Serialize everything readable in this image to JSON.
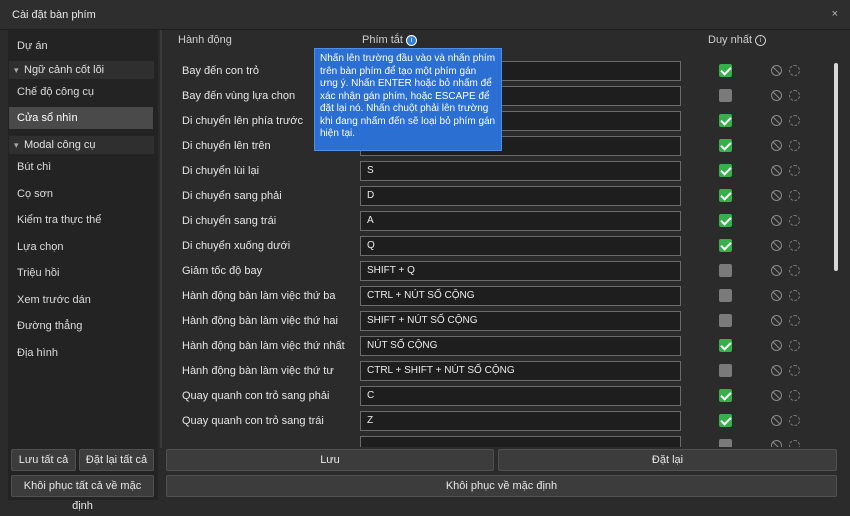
{
  "window": {
    "title": "Cài đặt bàn phím",
    "close": "×"
  },
  "sidebar": {
    "items": [
      {
        "label": "Dự án",
        "kind": "item"
      },
      {
        "label": "Ngữ cảnh cốt lõi",
        "kind": "group"
      },
      {
        "label": "Chế độ công cụ",
        "kind": "item"
      },
      {
        "label": "Cửa sổ nhìn",
        "kind": "item",
        "selected": true
      },
      {
        "label": "Modal công cụ",
        "kind": "group"
      },
      {
        "label": "Bút chì",
        "kind": "item"
      },
      {
        "label": "Cọ sơn",
        "kind": "item"
      },
      {
        "label": "Kiểm tra thực thể",
        "kind": "item"
      },
      {
        "label": "Lựa chọn",
        "kind": "item"
      },
      {
        "label": "Triệu hồi",
        "kind": "item"
      },
      {
        "label": "Xem trước dán",
        "kind": "item"
      },
      {
        "label": "Đường thẳng",
        "kind": "item"
      },
      {
        "label": "Địa hình",
        "kind": "item"
      }
    ],
    "save_all": "Lưu tất cả",
    "reset_all": "Đặt lại tất cả",
    "restore_all_defaults": "Khôi phục tất cả về mặc định"
  },
  "table": {
    "headers": {
      "action": "Hành động",
      "shortcut": "Phím tắt",
      "unique": "Duy nhất"
    },
    "rows": [
      {
        "action": "Bay đến con trỏ",
        "shortcut": "",
        "unique": true
      },
      {
        "action": "Bay đến vùng lựa chọn",
        "shortcut": "",
        "unique": false
      },
      {
        "action": "Di chuyển lên phía trước",
        "shortcut": "",
        "unique": true
      },
      {
        "action": "Di chuyển lên trên",
        "shortcut": "",
        "unique": true
      },
      {
        "action": "Di chuyển lùi lại",
        "shortcut": "S",
        "unique": true
      },
      {
        "action": "Di chuyển sang phải",
        "shortcut": "D",
        "unique": true
      },
      {
        "action": "Di chuyển sang trái",
        "shortcut": "A",
        "unique": true
      },
      {
        "action": "Di chuyển xuống dưới",
        "shortcut": "Q",
        "unique": true
      },
      {
        "action": "Giảm tốc độ bay",
        "shortcut": "SHIFT + Q",
        "unique": false
      },
      {
        "action": "Hành động bàn làm việc thứ ba",
        "shortcut": "CTRL + NÚT SỐ CỘNG",
        "unique": false
      },
      {
        "action": "Hành động bàn làm việc thứ hai",
        "shortcut": "SHIFT + NÚT SỐ CỘNG",
        "unique": false
      },
      {
        "action": "Hành động bàn làm việc thứ nhất",
        "shortcut": "NÚT SỐ CỘNG",
        "unique": true
      },
      {
        "action": "Hành động bàn làm việc thứ tư",
        "shortcut": "CTRL + SHIFT + NÚT SỐ CỘNG",
        "unique": false
      },
      {
        "action": "Quay quanh con trỏ sang phải",
        "shortcut": "C",
        "unique": true
      },
      {
        "action": "Quay quanh con trỏ sang trái",
        "shortcut": "Z",
        "unique": true
      },
      {
        "action": "",
        "shortcut": "",
        "unique": false
      }
    ]
  },
  "tooltip": {
    "text": "Nhấn lên trường đầu vào và nhấn phím trên bàn phím để tạo một phím gán ưng ý. Nhấn ENTER hoặc bỏ nhấm để xác nhận gán phím, hoặc ESCAPE để đặt lại nó. Nhấn chuột phải lên trường khi đang nhấm đến sẽ loại bỏ phím gán hiện tại."
  },
  "footer": {
    "save": "Lưu",
    "reset": "Đặt lại",
    "restore_defaults": "Khôi phục về mặc định"
  },
  "icons": {
    "info": "info-icon",
    "clear": "clear-binding-icon",
    "reset": "reset-binding-icon",
    "check": "check-icon"
  },
  "colors": {
    "accent": "#2a6fd1",
    "checked": "#35b04a",
    "unchecked": "#7a7a7a"
  }
}
